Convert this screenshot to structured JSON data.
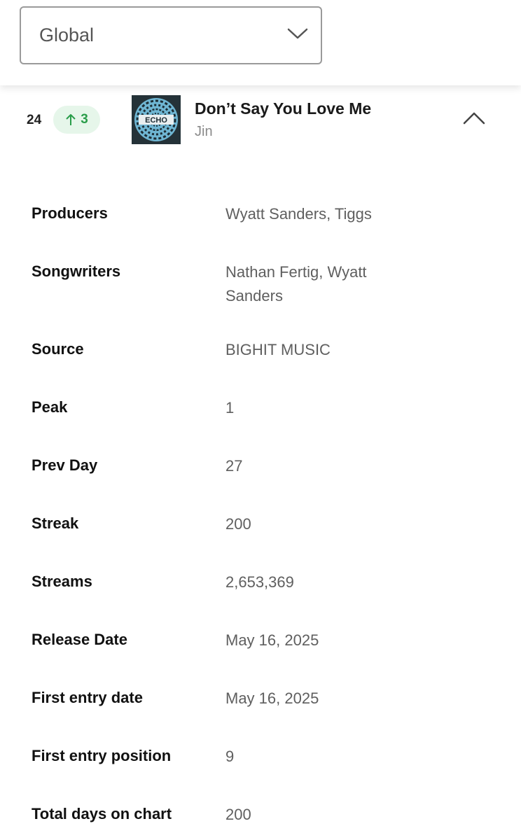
{
  "region_select": {
    "value": "Global"
  },
  "entry": {
    "rank": "24",
    "movement": {
      "direction": "up",
      "amount": "3"
    },
    "title": "Don’t Say You Love Me",
    "artist": "Jin",
    "cover_text": "ECHO"
  },
  "details": [
    {
      "label": "Producers",
      "value": "Wyatt Sanders, Tiggs"
    },
    {
      "label": "Songwriters",
      "value": "Nathan Fertig, Wyatt Sanders"
    },
    {
      "label": "Source",
      "value": "BIGHIT MUSIC"
    },
    {
      "label": "Peak",
      "value": "1"
    },
    {
      "label": "Prev Day",
      "value": "27"
    },
    {
      "label": "Streak",
      "value": "200"
    },
    {
      "label": "Streams",
      "value": "2,653,369"
    },
    {
      "label": "Release Date",
      "value": "May 16, 2025"
    },
    {
      "label": "First entry date",
      "value": "May 16, 2025"
    },
    {
      "label": "First entry position",
      "value": "9"
    },
    {
      "label": "Total days on chart",
      "value": "200"
    }
  ],
  "colors": {
    "up_green": "#2a9d4a",
    "badge_bg": "#e6f6ea"
  }
}
